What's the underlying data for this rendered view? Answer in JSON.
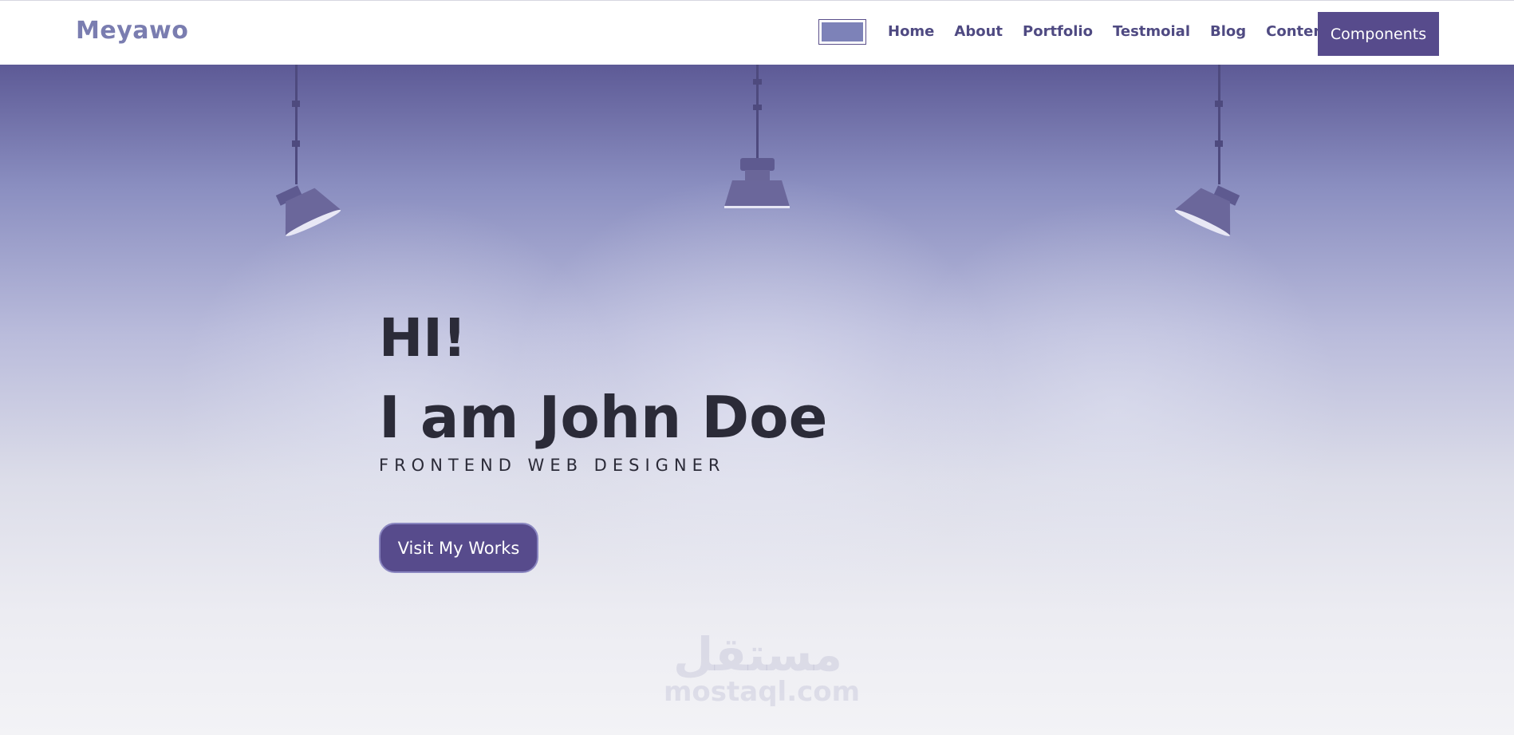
{
  "navbar": {
    "brand": "Meyawo",
    "links": [
      "Home",
      "About",
      "Portfolio",
      "Testmoial",
      "Blog",
      "Content"
    ],
    "components_button": "Components"
  },
  "hero": {
    "greeting": "HI!",
    "name": "I am John Doe",
    "subtitle": "FRONTEND WEB DESIGNER",
    "cta_label": "Visit My Works"
  },
  "watermark": {
    "arabic": "مستقل",
    "latin": "mostaql.com"
  },
  "icons": [
    "menu-toggle-icon",
    "spotlight-lamp-icon"
  ],
  "colors": {
    "brand": "#7a7db0",
    "nav_link": "#4f4a82",
    "primary": "#574b8c",
    "hero_top": "#5d5a96",
    "hero_bottom": "#f3f3f6",
    "text_dark": "#2b2b38"
  }
}
